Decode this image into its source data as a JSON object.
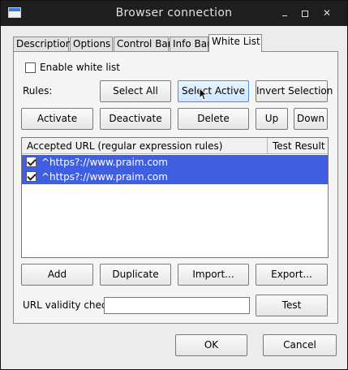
{
  "window": {
    "title": "Browser connection",
    "icon": "app-window-icon"
  },
  "tabs": [
    {
      "label": "Description"
    },
    {
      "label": "Options"
    },
    {
      "label": "Control Bar"
    },
    {
      "label": "Info Bar"
    },
    {
      "label": "White List",
      "active": true
    }
  ],
  "whitelist": {
    "enable_label": "Enable white list",
    "enable_checked": false,
    "rules_label": "Rules:",
    "select_all": "Select All",
    "select_active": "Select Active",
    "invert_selection": "Invert Selection",
    "activate": "Activate",
    "deactivate": "Deactivate",
    "delete": "Delete",
    "up": "Up",
    "down": "Down",
    "table": {
      "headers": [
        "Accepted URL (regular expression rules)",
        "Test Result"
      ],
      "rows": [
        {
          "checked": true,
          "url": "^https?://www.praim.com",
          "result": ""
        },
        {
          "checked": true,
          "url": "^https?://www.praim.com",
          "result": ""
        }
      ]
    },
    "add": "Add",
    "duplicate": "Duplicate",
    "import": "Import...",
    "export": "Export...",
    "url_check_label": "URL validity check",
    "url_check_value": "",
    "test": "Test"
  },
  "dialog": {
    "ok": "OK",
    "cancel": "Cancel"
  },
  "colors": {
    "selection": "#3f5fe0",
    "titlebar": "#1e1e1e",
    "hover_button": "#cfe6ff"
  }
}
